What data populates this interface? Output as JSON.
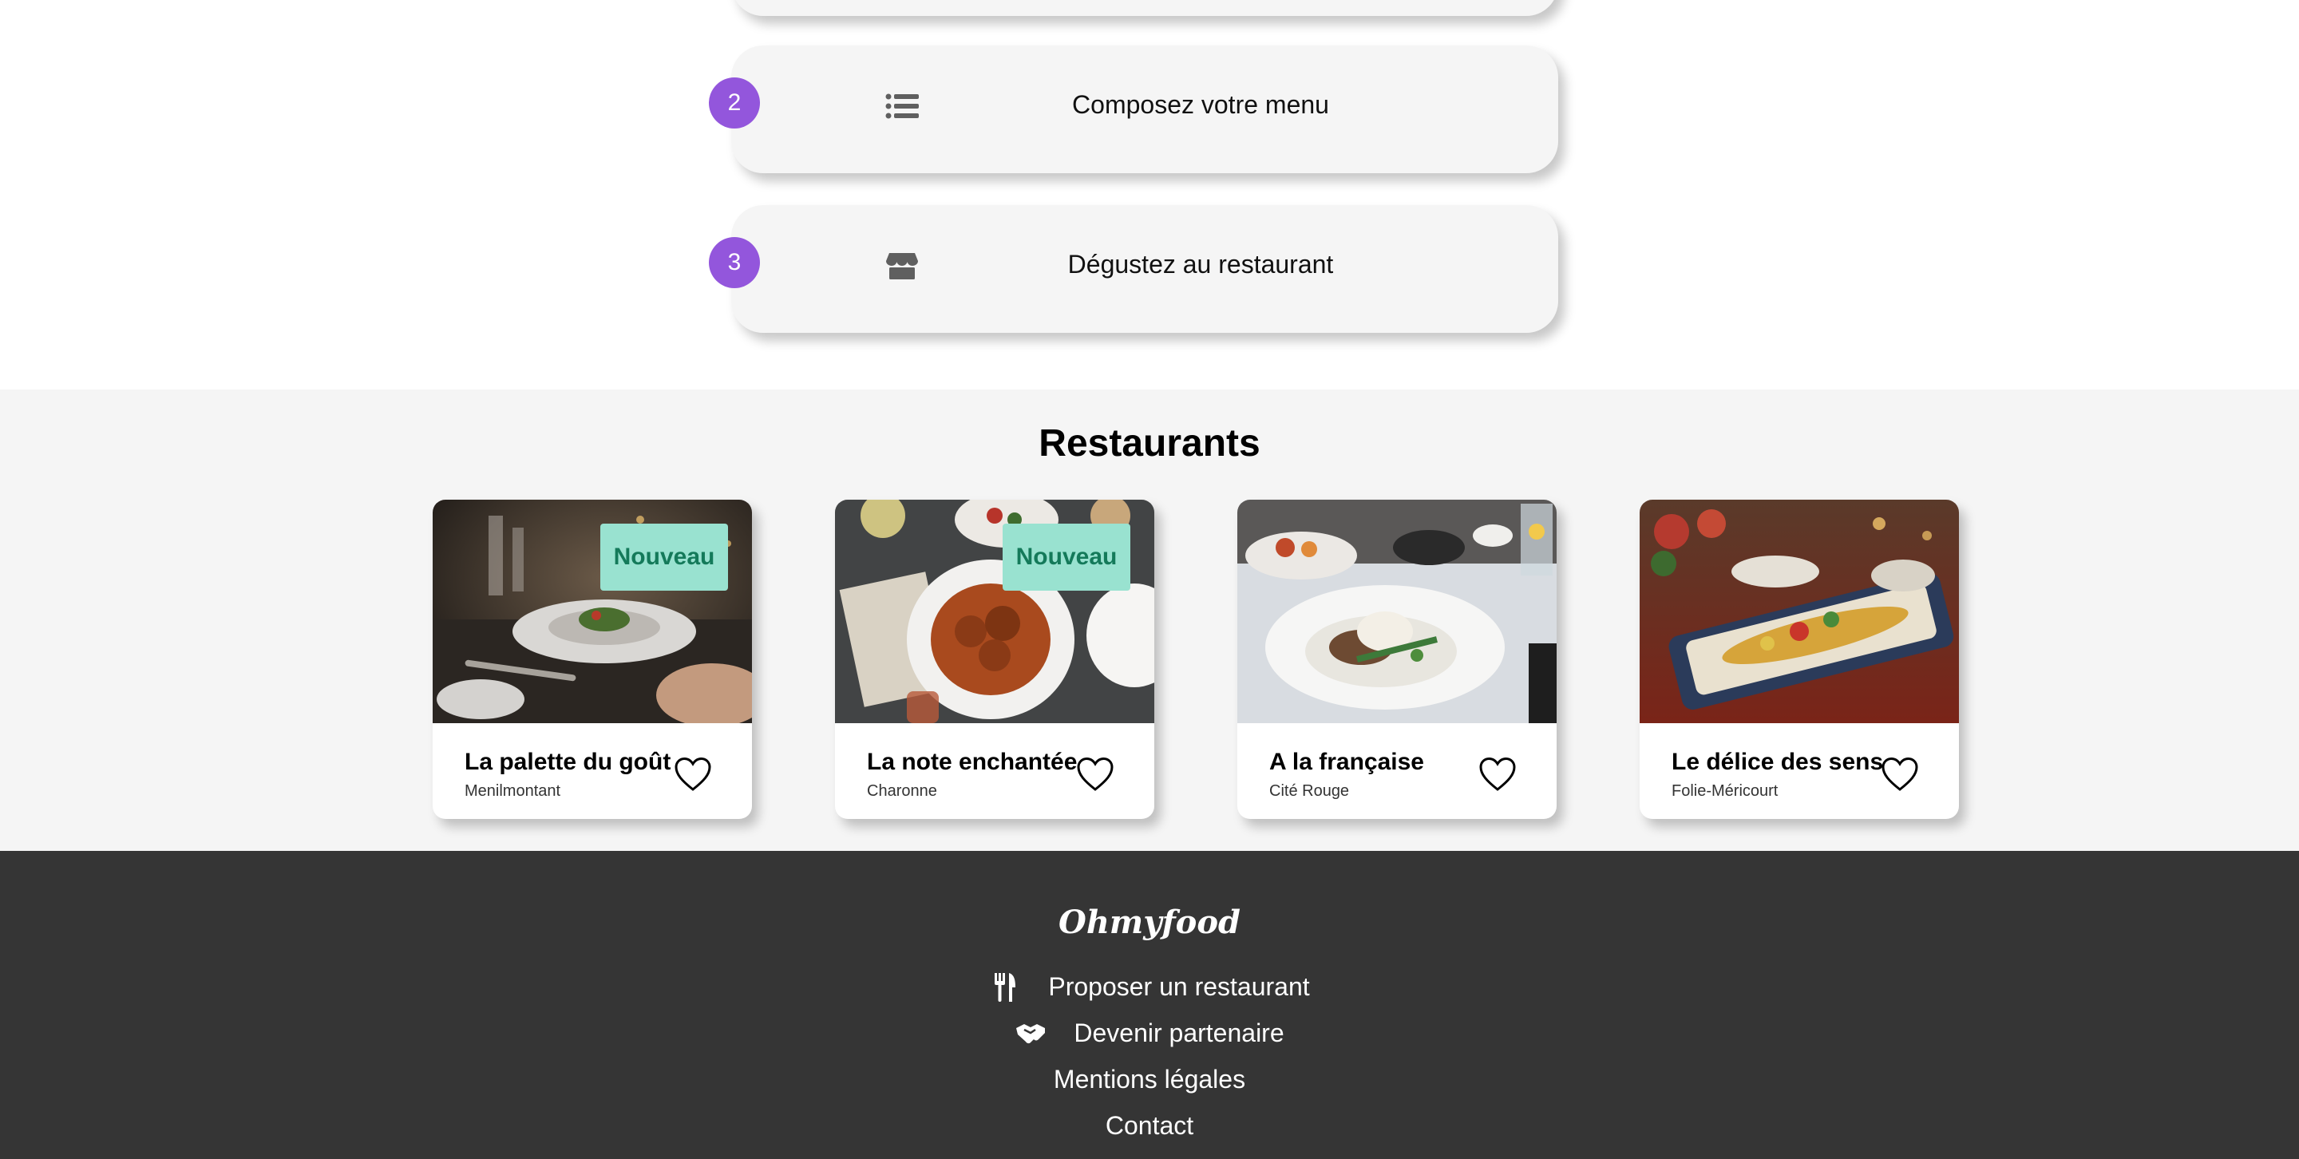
{
  "steps": [
    {
      "number": "2",
      "icon": "list-icon",
      "label": "Composez votre menu"
    },
    {
      "number": "3",
      "icon": "store-icon",
      "label": "Dégustez au restaurant"
    }
  ],
  "restaurants": {
    "title": "Restaurants",
    "items": [
      {
        "name": "La palette du goût",
        "location": "Menilmontant",
        "badge": "Nouveau"
      },
      {
        "name": "La note enchantée",
        "location": "Charonne",
        "badge": "Nouveau"
      },
      {
        "name": "A la française",
        "location": "Cité Rouge"
      },
      {
        "name": "Le délice des sens",
        "location": "Folie-Méricourt"
      }
    ]
  },
  "footer": {
    "brand": "Ohmyfood",
    "links": [
      {
        "label": "Proposer un restaurant",
        "icon": "utensils-icon"
      },
      {
        "label": "Devenir partenaire",
        "icon": "handshake-icon"
      },
      {
        "label": "Mentions légales"
      },
      {
        "label": "Contact"
      }
    ]
  },
  "colors": {
    "accent": "#9356dc",
    "badge_bg": "#99e2d0",
    "badge_text": "#147a5a",
    "footer_bg": "#353535",
    "section_bg": "#f5f5f5"
  }
}
